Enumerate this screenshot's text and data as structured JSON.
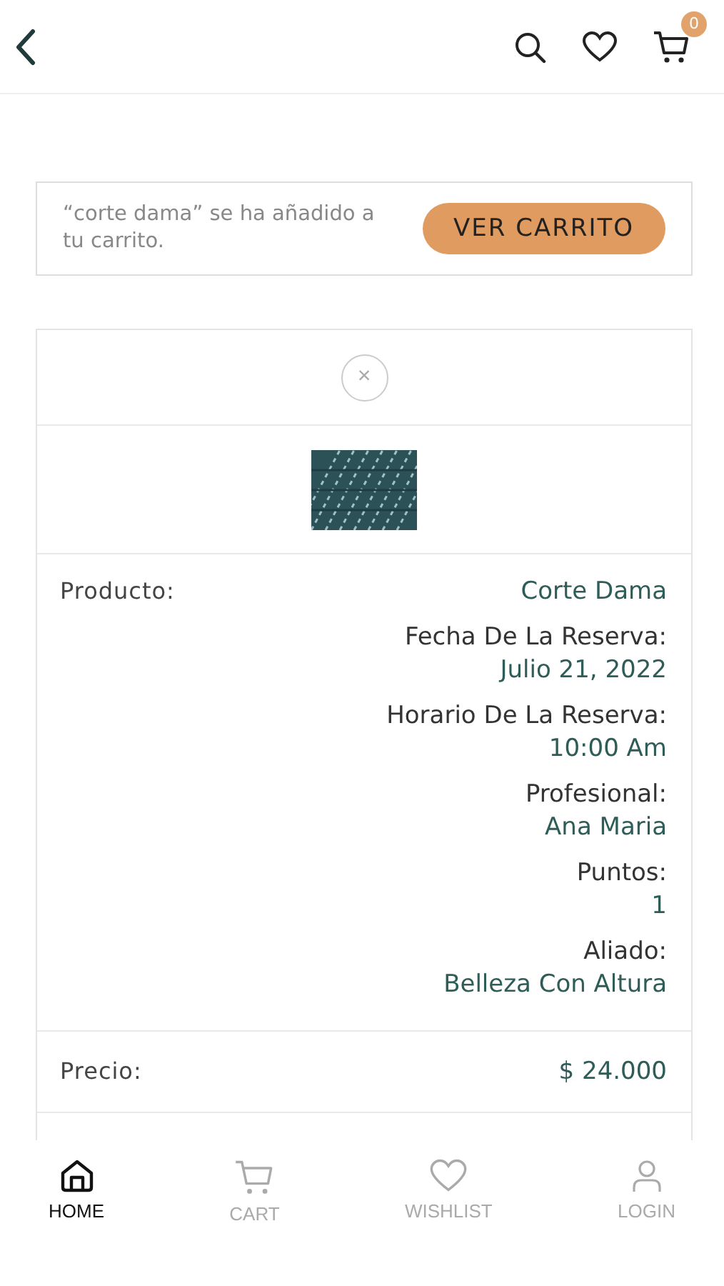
{
  "header": {
    "cart_badge": "0"
  },
  "notice": {
    "message": "“corte dama” se ha añadido a tu carrito.",
    "button": "VER CARRITO"
  },
  "cart_item": {
    "remove": "×",
    "details": [
      {
        "label": "Producto:",
        "value": "Corte Dama",
        "kind": "inline"
      },
      {
        "label": "Fecha De La Reserva:",
        "value": "Julio 21, 2022",
        "kind": "stacked"
      },
      {
        "label": "Horario De La Reserva:",
        "value": "10:00 Am",
        "kind": "stacked"
      },
      {
        "label": "Profesional:",
        "value": "Ana Maria",
        "kind": "stacked"
      },
      {
        "label": "Puntos:",
        "value": "1",
        "kind": "stacked"
      },
      {
        "label": "Aliado:",
        "value": "Belleza Con Altura",
        "kind": "stacked"
      }
    ],
    "price": {
      "label": "Precio:",
      "value": "$ 24.000"
    }
  },
  "tab_bar": [
    {
      "label": "HOME",
      "kind": "home",
      "selected": true
    },
    {
      "label": "CART",
      "kind": "cart",
      "selected": false
    },
    {
      "label": "WISHLIST",
      "kind": "heart",
      "selected": false
    },
    {
      "label": "LOGIN",
      "kind": "user",
      "selected": false
    }
  ]
}
